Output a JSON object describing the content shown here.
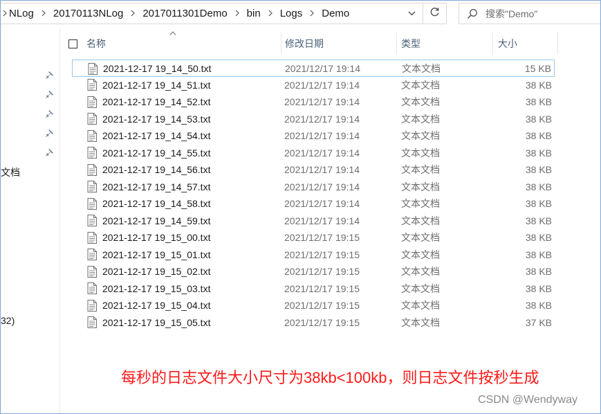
{
  "address_bar": {
    "breadcrumbs": [
      "NLog",
      "20170113NLog",
      "2017011301Demo",
      "bin",
      "Logs",
      "Demo"
    ],
    "dropdown_icon": "chevron-down-icon",
    "refresh_icon": "refresh-icon"
  },
  "search": {
    "placeholder": "搜索\"Demo\"",
    "icon": "search-icon"
  },
  "navigation_pane": {
    "partial_labels": [
      "文档",
      "32)"
    ],
    "pin_icon": "pin-icon"
  },
  "columns": {
    "name": "名称",
    "date_modified": "修改日期",
    "type": "类型",
    "size": "大小"
  },
  "files": [
    {
      "name": "2021-12-17 19_14_50.txt",
      "date": "2021/12/17 19:14",
      "type": "文本文档",
      "size": "15 KB"
    },
    {
      "name": "2021-12-17 19_14_51.txt",
      "date": "2021/12/17 19:14",
      "type": "文本文档",
      "size": "38 KB"
    },
    {
      "name": "2021-12-17 19_14_52.txt",
      "date": "2021/12/17 19:14",
      "type": "文本文档",
      "size": "38 KB"
    },
    {
      "name": "2021-12-17 19_14_53.txt",
      "date": "2021/12/17 19:14",
      "type": "文本文档",
      "size": "38 KB"
    },
    {
      "name": "2021-12-17 19_14_54.txt",
      "date": "2021/12/17 19:14",
      "type": "文本文档",
      "size": "38 KB"
    },
    {
      "name": "2021-12-17 19_14_55.txt",
      "date": "2021/12/17 19:14",
      "type": "文本文档",
      "size": "38 KB"
    },
    {
      "name": "2021-12-17 19_14_56.txt",
      "date": "2021/12/17 19:14",
      "type": "文本文档",
      "size": "38 KB"
    },
    {
      "name": "2021-12-17 19_14_57.txt",
      "date": "2021/12/17 19:14",
      "type": "文本文档",
      "size": "38 KB"
    },
    {
      "name": "2021-12-17 19_14_58.txt",
      "date": "2021/12/17 19:14",
      "type": "文本文档",
      "size": "38 KB"
    },
    {
      "name": "2021-12-17 19_14_59.txt",
      "date": "2021/12/17 19:14",
      "type": "文本文档",
      "size": "38 KB"
    },
    {
      "name": "2021-12-17 19_15_00.txt",
      "date": "2021/12/17 19:15",
      "type": "文本文档",
      "size": "38 KB"
    },
    {
      "name": "2021-12-17 19_15_01.txt",
      "date": "2021/12/17 19:15",
      "type": "文本文档",
      "size": "38 KB"
    },
    {
      "name": "2021-12-17 19_15_02.txt",
      "date": "2021/12/17 19:15",
      "type": "文本文档",
      "size": "38 KB"
    },
    {
      "name": "2021-12-17 19_15_03.txt",
      "date": "2021/12/17 19:15",
      "type": "文本文档",
      "size": "38 KB"
    },
    {
      "name": "2021-12-17 19_15_04.txt",
      "date": "2021/12/17 19:15",
      "type": "文本文档",
      "size": "38 KB"
    },
    {
      "name": "2021-12-17 19_15_05.txt",
      "date": "2021/12/17 19:15",
      "type": "文本文档",
      "size": "37 KB"
    }
  ],
  "selected_index": 0,
  "file_icon": "text-file-icon",
  "annotation": "每秒的日志文件大小尺寸为38kb<100kb，则日志文件按秒生成",
  "watermark": "CSDN @Wendyway",
  "colors": {
    "annotation": "#ff1a1a",
    "header_text": "#4c607a",
    "selection_border": "#99c9ef",
    "frame_border": "#7da7d9",
    "secondary_text": "#6d6d6d"
  }
}
